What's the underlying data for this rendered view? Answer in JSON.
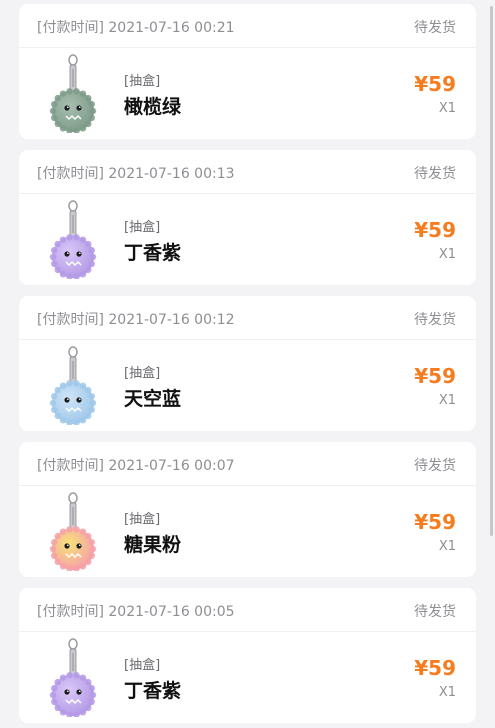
{
  "orders": [
    {
      "pay_time": "[付款时间] 2021-07-16 00:21",
      "status": "待发货",
      "tag": "[抽盒]",
      "name": "橄榄绿",
      "price": "¥59",
      "qty": "X1",
      "thumb_color": "#7f9b8a",
      "thumb_highlight": "#a7bfb0",
      "thumb_icon": "plush-keychain-olive-icon"
    },
    {
      "pay_time": "[付款时间] 2021-07-16 00:13",
      "status": "待发货",
      "tag": "[抽盒]",
      "name": "丁香紫",
      "price": "¥59",
      "qty": "X1",
      "thumb_color": "#b49ae6",
      "thumb_highlight": "#d9c8f7",
      "thumb_icon": "plush-keychain-lilac-icon"
    },
    {
      "pay_time": "[付款时间] 2021-07-16 00:12",
      "status": "待发货",
      "tag": "[抽盒]",
      "name": "天空蓝",
      "price": "¥59",
      "qty": "X1",
      "thumb_color": "#9fc8ea",
      "thumb_highlight": "#cfe4f6",
      "thumb_icon": "plush-keychain-sky-icon"
    },
    {
      "pay_time": "[付款时间] 2021-07-16 00:07",
      "status": "待发货",
      "tag": "[抽盒]",
      "name": "糖果粉",
      "price": "¥59",
      "qty": "X1",
      "thumb_color": "#f6a0a8",
      "thumb_highlight": "#f7e27a",
      "thumb_icon": "plush-keychain-candy-icon"
    },
    {
      "pay_time": "[付款时间] 2021-07-16 00:05",
      "status": "待发货",
      "tag": "[抽盒]",
      "name": "丁香紫",
      "price": "¥59",
      "qty": "X1",
      "thumb_color": "#b49ae6",
      "thumb_highlight": "#d9c8f7",
      "thumb_icon": "plush-keychain-lilac-icon"
    }
  ],
  "colors": {
    "page_bg": "#f3f3f5",
    "card_bg": "#ffffff",
    "accent_price": "#f57c1f",
    "muted_text": "#8e8e93"
  }
}
